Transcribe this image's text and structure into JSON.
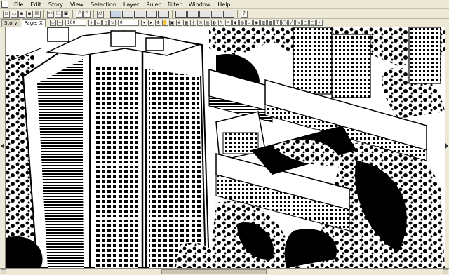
{
  "menu": {
    "items": [
      "File",
      "Edit",
      "Story",
      "View",
      "Selection",
      "Layer",
      "Ruler",
      "Filter",
      "Window",
      "Help"
    ]
  },
  "tabbar": {
    "tabs": [
      {
        "label": "Story"
      },
      {
        "label": "Page: X"
      }
    ],
    "zoom_value": "100",
    "rotation_value": "0"
  },
  "toolbar": {
    "icons": [
      "new-icon",
      "open-icon",
      "save-icon",
      "cut-icon",
      "copy-icon",
      "paste-icon",
      "undo-icon",
      "redo-icon",
      "print-icon",
      "view-mode-icon"
    ]
  },
  "colors": {
    "chrome": "#ece9d8",
    "ink": "#000000",
    "paper": "#ffffff"
  }
}
